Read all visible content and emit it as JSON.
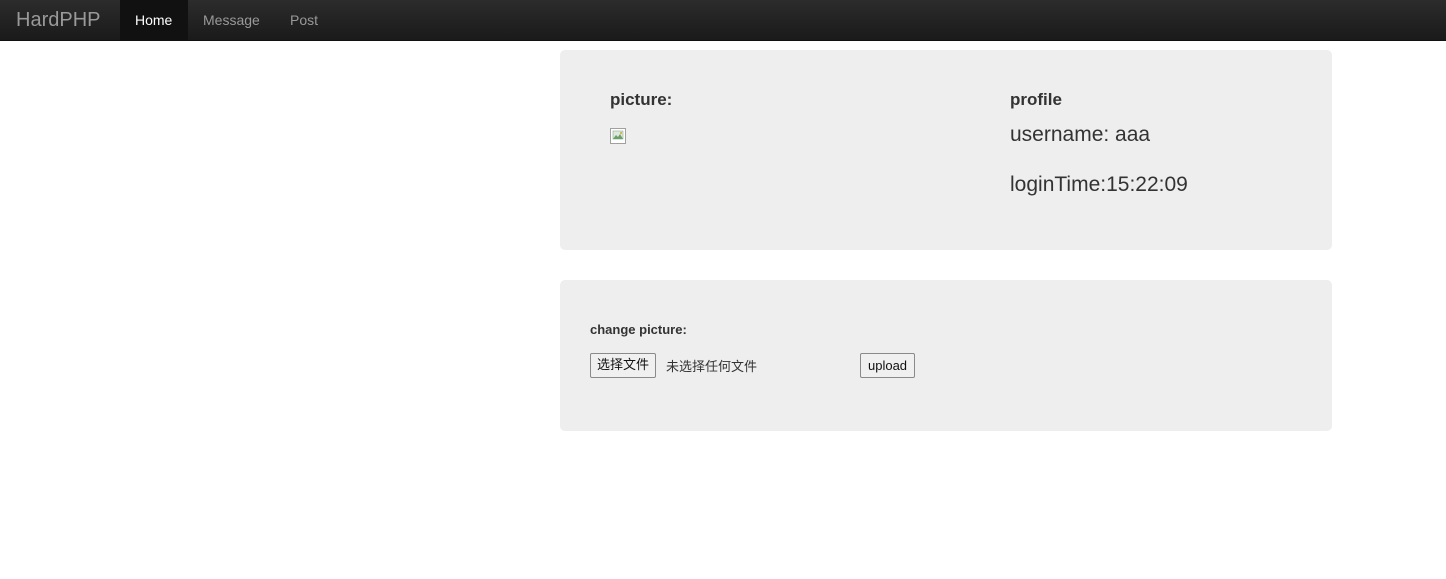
{
  "navbar": {
    "brand": "HardPHP",
    "items": [
      {
        "label": "Home",
        "active": true
      },
      {
        "label": "Message",
        "active": false
      },
      {
        "label": "Post",
        "active": false
      }
    ]
  },
  "profile_panel": {
    "picture_label": "picture:",
    "profile_label": "profile",
    "username_line": "username: aaa",
    "login_time_line": "loginTime:15:22:09"
  },
  "upload_panel": {
    "change_label": "change picture:",
    "file_button_label": "选择文件",
    "file_status": "未选择任何文件",
    "upload_button_label": "upload"
  },
  "colors": {
    "navbar_bg": "#1f1f1f",
    "active_nav_bg": "#111111",
    "panel_bg": "#eeeeee"
  }
}
